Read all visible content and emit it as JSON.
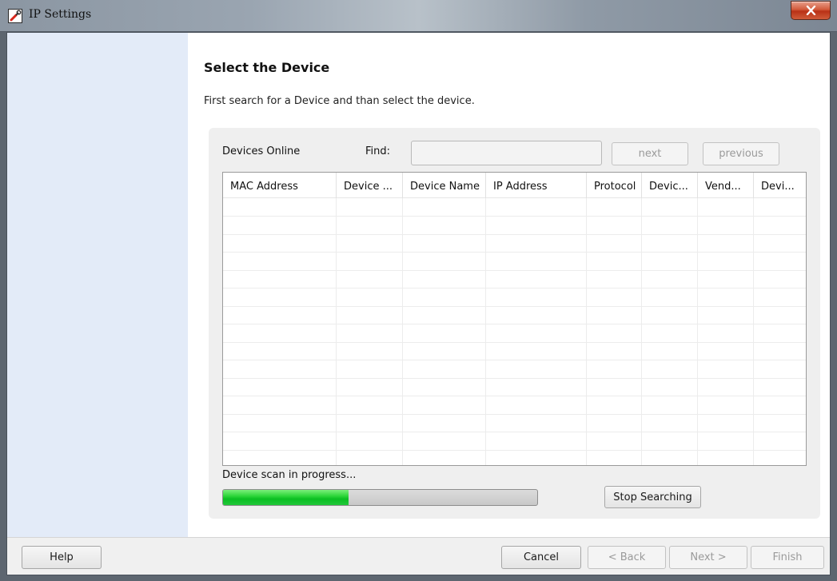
{
  "window": {
    "title": "IP Settings",
    "app_icon": "wrench-icon",
    "close_icon": "close-icon"
  },
  "page": {
    "heading": "Select the Device",
    "subtitle": "First search for a Device and than select the device."
  },
  "devices": {
    "online_label": "Devices Online",
    "find_label": "Find:",
    "find_value": "",
    "next_label": "next",
    "previous_label": "previous",
    "columns": [
      "MAC Address",
      "Device ...",
      "Device Name",
      "IP Address",
      "Protocol",
      "Devic...",
      "Vend...",
      "Devi..."
    ],
    "rows": []
  },
  "scan": {
    "status": "Device scan in progress...",
    "progress": 0.4,
    "stop_label": "Stop Searching"
  },
  "footer": {
    "help_label": "Help",
    "cancel_label": "Cancel",
    "back_label": "< Back",
    "next_label": "Next >",
    "finish_label": "Finish"
  },
  "colors": {
    "left_panel": "#e3ebf8",
    "progress_fill": "#1ec932",
    "close_button": "#c8472a"
  }
}
